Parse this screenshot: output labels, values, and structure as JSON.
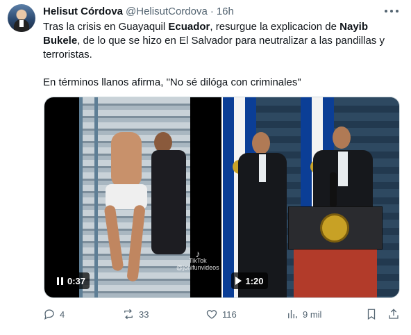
{
  "author": {
    "name": "Helisut Córdova",
    "handle": "@HelisutCordova",
    "separator": "·",
    "time": "16h"
  },
  "tweet": {
    "line1": {
      "a": "Tras la crisis en Guayaquil ",
      "b": "Ecuador",
      "c": ", resurgue la explicacion de ",
      "d": "Nayib"
    },
    "line2": {
      "a": "Bukele",
      "b": ", de lo que se hizo en El Salvador para neutralizar a las pandillas y"
    },
    "line3": "terroristas.",
    "line4": "En términos llanos afirma, \"No sé dilóga con criminales\""
  },
  "media": {
    "video1": {
      "duration": "0:37",
      "state_icon": "pause-icon",
      "watermark_logo": "TikTok",
      "watermark_user": "@jonifunvideos"
    },
    "video2": {
      "duration": "1:20",
      "state_icon": "play-icon"
    }
  },
  "actions": {
    "replies": "4",
    "reposts": "33",
    "likes": "116",
    "views": "9 mil"
  },
  "colors": {
    "text": "#0f1419",
    "secondary": "#536471",
    "border": "#cfd9de"
  }
}
